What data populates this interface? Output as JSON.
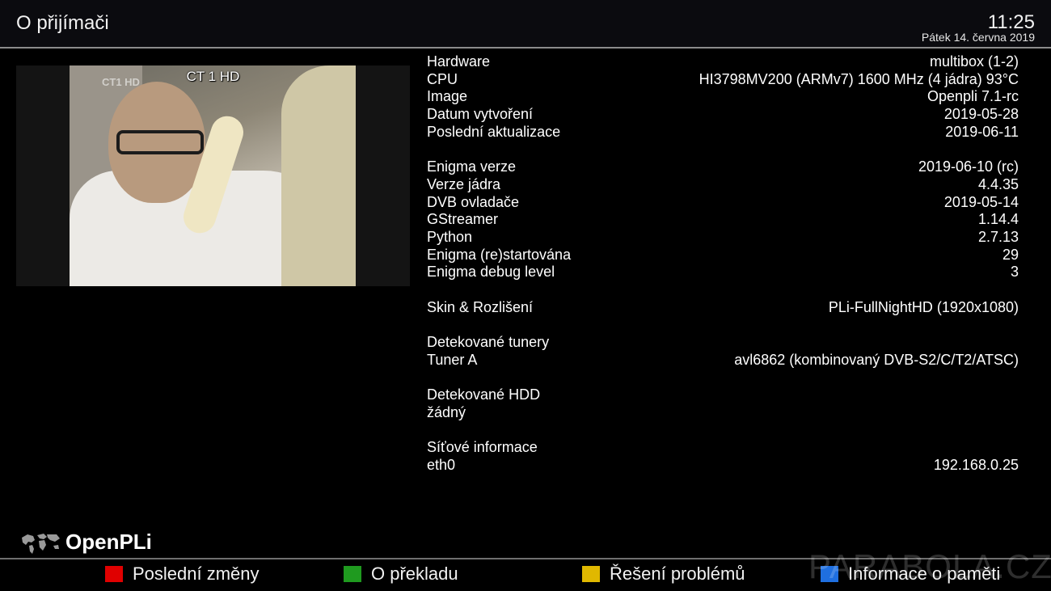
{
  "header": {
    "title": "O přijímači",
    "time": "11:25",
    "date": "Pátek 14. června 2019"
  },
  "preview": {
    "channel": "CT 1 HD",
    "overlay_logo": "CT1 HD"
  },
  "info": {
    "hardware": {
      "label": "Hardware",
      "value": "multibox (1-2)"
    },
    "cpu": {
      "label": "CPU",
      "value": "HI3798MV200 (ARMv7) 1600 MHz (4 jádra) 93°C"
    },
    "image": {
      "label": "Image",
      "value": "Openpli 7.1-rc"
    },
    "created": {
      "label": "Datum vytvoření",
      "value": "2019-05-28"
    },
    "updated": {
      "label": "Poslední aktualizace",
      "value": "2019-06-11"
    },
    "enigma": {
      "label": "Enigma verze",
      "value": "2019-06-10 (rc)"
    },
    "kernel": {
      "label": "Verze jádra",
      "value": "4.4.35"
    },
    "dvb": {
      "label": "DVB ovladače",
      "value": "2019-05-14"
    },
    "gstreamer": {
      "label": "GStreamer",
      "value": "1.14.4"
    },
    "python": {
      "label": "Python",
      "value": "2.7.13"
    },
    "restarts": {
      "label": "Enigma (re)startována",
      "value": "29"
    },
    "debug": {
      "label": "Enigma debug level",
      "value": "3"
    },
    "skin": {
      "label": "Skin & Rozlišení",
      "value": "PLi-FullNightHD (1920x1080)"
    },
    "tuners_heading": "Detekované tunery",
    "tuner_a": {
      "label": "Tuner A",
      "value": "avl6862 (kombinovaný DVB-S2/C/T2/ATSC)"
    },
    "hdd_heading": "Detekované HDD",
    "hdd_none": "žádný",
    "net_heading": "Síťové informace",
    "eth0": {
      "label": "eth0",
      "value": "192.168.0.25"
    }
  },
  "logo": {
    "text": "OpenPLi",
    "icon": "world-map-icon"
  },
  "buttons": {
    "red": {
      "label": "Poslední změny",
      "color": "#e00000"
    },
    "green": {
      "label": "O překladu",
      "color": "#1f9a1f"
    },
    "yellow": {
      "label": "Řešení problémů",
      "color": "#e0b800"
    },
    "blue": {
      "label": "Informace o paměti",
      "color": "#1f6fe0"
    }
  },
  "watermark": "PARABOLA.CZ"
}
